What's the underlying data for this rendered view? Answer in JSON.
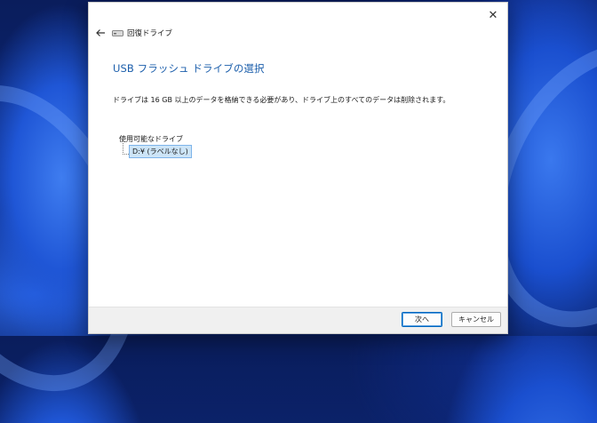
{
  "window": {
    "title": "回復ドライブ",
    "close_glyph": "✕"
  },
  "page": {
    "heading": "USB フラッシュ ドライブの選択",
    "description": "ドライブは 16 GB 以上のデータを格納できる必要があり、ドライブ上のすべてのデータは削除されます。"
  },
  "drives": {
    "label": "使用可能なドライブ",
    "items": [
      {
        "label": "D:¥ (ラベルなし)",
        "selected": true
      }
    ]
  },
  "buttons": {
    "next": "次へ",
    "cancel": "キャンセル"
  },
  "icons": {
    "back": "back-arrow-icon",
    "drive": "drive-icon",
    "close": "close-icon"
  }
}
